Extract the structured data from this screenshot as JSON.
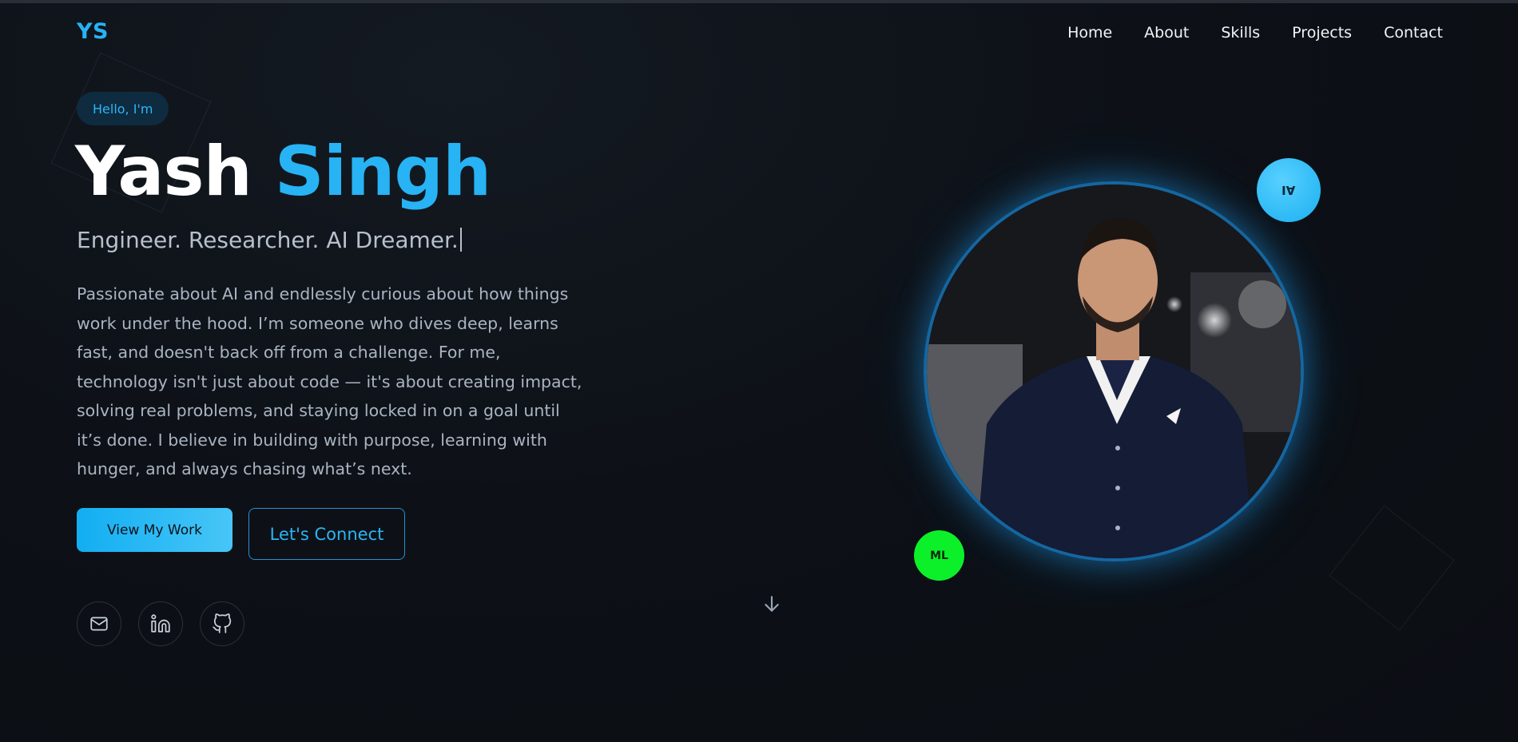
{
  "logo": "YS",
  "nav": {
    "items": [
      {
        "label": "Home"
      },
      {
        "label": "About"
      },
      {
        "label": "Skills"
      },
      {
        "label": "Projects"
      },
      {
        "label": "Contact"
      }
    ]
  },
  "hero": {
    "badge": "Hello, I'm",
    "first_name": "Yash",
    "last_name": "Singh",
    "tagline": "Engineer. Researcher. AI Dreamer.",
    "bio": "Passionate about AI and endlessly curious about how things work under the hood. I’m someone who dives deep, learns fast, and doesn't back off from a challenge. For me, technology isn't just about code — it's about creating impact, solving real problems, and staying locked in on a goal until it’s done. I believe in building with purpose, learning with hunger, and always chasing what’s next.",
    "primary_button": "View My Work",
    "secondary_button": "Let's Connect"
  },
  "social": {
    "icons": [
      "mail-icon",
      "linkedin-icon",
      "github-icon"
    ]
  },
  "badges": {
    "ai": "AI",
    "ml": "ML"
  },
  "colors": {
    "accent": "#27b3f4",
    "background": "#0d1117",
    "ml_badge": "#0cf02a"
  }
}
